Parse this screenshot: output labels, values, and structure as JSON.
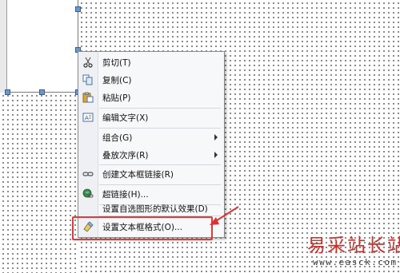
{
  "context_menu": {
    "items": [
      {
        "label": "剪切(T)",
        "icon": "scissors-icon"
      },
      {
        "label": "复制(C)",
        "icon": "copy-icon"
      },
      {
        "label": "粘贴(P)",
        "icon": "paste-icon"
      },
      {
        "label": "编辑文字(X)",
        "icon": "edit-text-icon"
      },
      {
        "label": "组合(G)",
        "has_submenu": true
      },
      {
        "label": "叠放次序(R)",
        "has_submenu": true
      },
      {
        "label": "创建文本框链接(R)",
        "icon": "link-chain-icon"
      },
      {
        "label": "超链接(H)...",
        "icon": "hyperlink-globe-icon"
      },
      {
        "label": "设置自选图形的默认效果(D)"
      },
      {
        "label": "设置文本框格式(O)...",
        "icon": "format-textbox-icon",
        "highlighted": true
      }
    ]
  },
  "annotation": {
    "highlight_color": "#e03a3a"
  },
  "watermark": {
    "title": "易采站长站",
    "url": "www.easck.com"
  }
}
